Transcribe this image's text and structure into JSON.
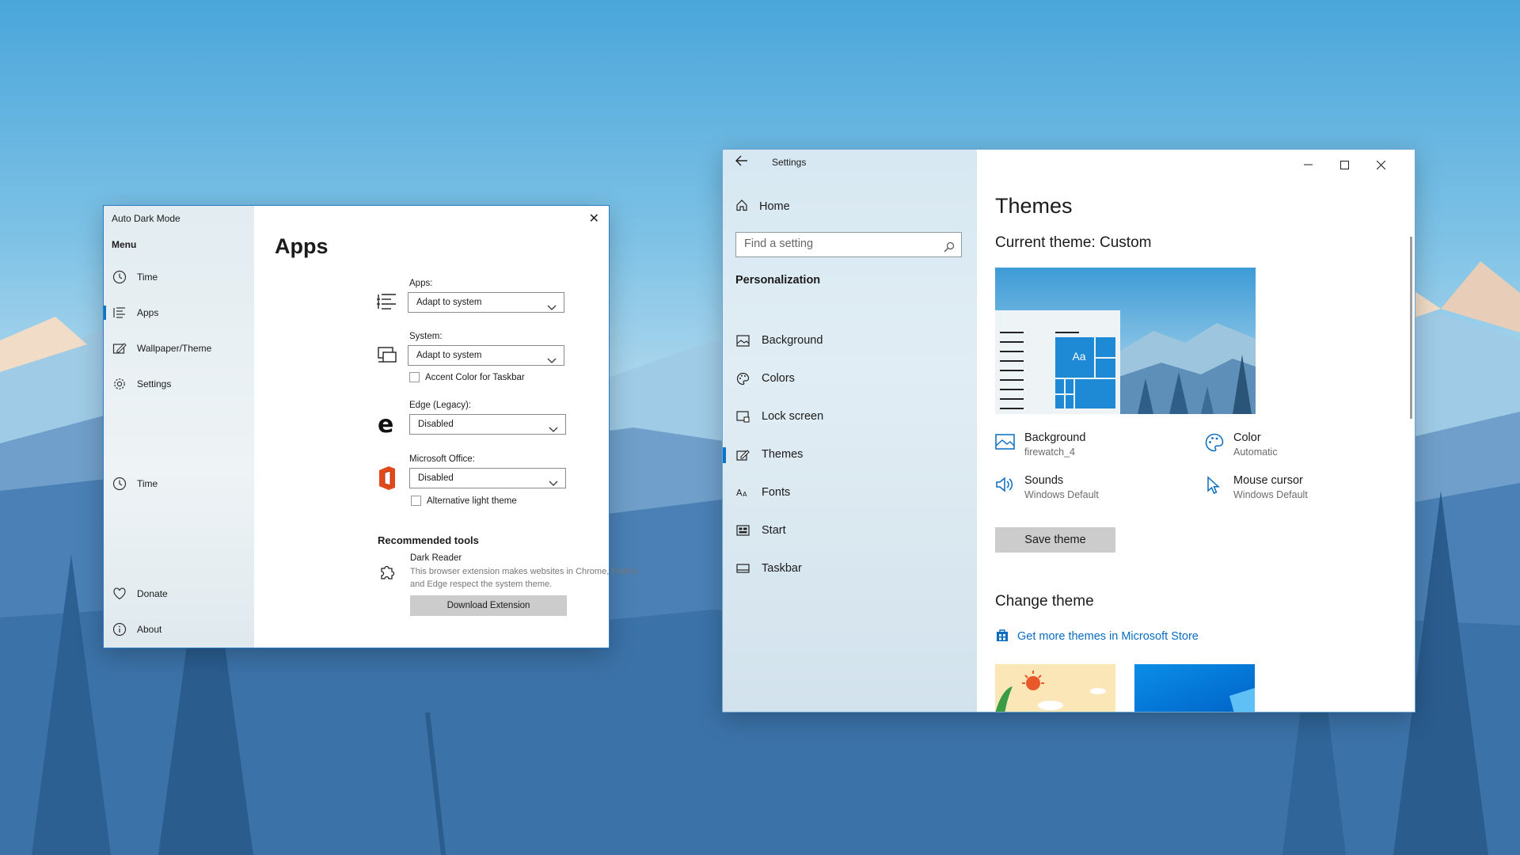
{
  "desktop": {
    "wallpaper": "firewatch mountain landscape",
    "sky_color": "#4aa6da"
  },
  "auto_dark_mode": {
    "window_title": "Auto Dark Mode",
    "close_icon": "close-icon",
    "menu_heading": "Menu",
    "nav": [
      {
        "label": "Time",
        "icon": "clock-icon",
        "active": false
      },
      {
        "label": "Apps",
        "icon": "list-icon",
        "active": true
      },
      {
        "label": "Wallpaper/Theme",
        "icon": "wallpaper-icon",
        "active": false
      },
      {
        "label": "Settings",
        "icon": "gear-icon",
        "active": false
      }
    ],
    "bottom_nav": [
      {
        "label": "Donate",
        "icon": "heart-icon"
      },
      {
        "label": "About",
        "icon": "info-icon"
      }
    ],
    "page_title": "Apps",
    "apps": {
      "label": "Apps:",
      "value": "Adapt to system"
    },
    "system": {
      "label": "System:",
      "value": "Adapt to system",
      "checkbox_label": "Accent Color for Taskbar",
      "checked": false
    },
    "edge": {
      "label": "Edge (Legacy):",
      "value": "Disabled"
    },
    "office": {
      "label": "Microsoft Office:",
      "value": "Disabled",
      "checkbox_label": "Alternative light theme",
      "checked": false
    },
    "recommended": {
      "heading": "Recommended tools",
      "tool_name": "Dark Reader",
      "tool_desc": "This browser extension makes websites in Chrome, Firefox and Edge respect the system theme.",
      "button": "Download Extension"
    },
    "accent_color": "#0a74c9"
  },
  "settings": {
    "window_title": "Settings",
    "home_label": "Home",
    "search_placeholder": "Find a setting",
    "section_heading": "Personalization",
    "nav": [
      {
        "label": "Background",
        "icon": "picture-icon",
        "active": false
      },
      {
        "label": "Colors",
        "icon": "palette-icon",
        "active": false
      },
      {
        "label": "Lock screen",
        "icon": "lock-screen-icon",
        "active": false
      },
      {
        "label": "Themes",
        "icon": "brush-icon",
        "active": true
      },
      {
        "label": "Fonts",
        "icon": "font-icon",
        "active": false
      },
      {
        "label": "Start",
        "icon": "start-icon",
        "active": false
      },
      {
        "label": "Taskbar",
        "icon": "taskbar-icon",
        "active": false
      }
    ],
    "page_title": "Themes",
    "current_theme": "Current theme: Custom",
    "preview_tile_text": "Aa",
    "attributes": [
      {
        "title": "Background",
        "value": "firewatch_4",
        "icon": "picture-icon"
      },
      {
        "title": "Color",
        "value": "Automatic",
        "icon": "palette-icon"
      },
      {
        "title": "Sounds",
        "value": "Windows Default",
        "icon": "speaker-icon"
      },
      {
        "title": "Mouse cursor",
        "value": "Windows Default",
        "icon": "cursor-icon"
      }
    ],
    "save_button": "Save theme",
    "change_heading": "Change theme",
    "store_link": "Get more themes in Microsoft Store",
    "link_color": "#0a6cc0"
  }
}
